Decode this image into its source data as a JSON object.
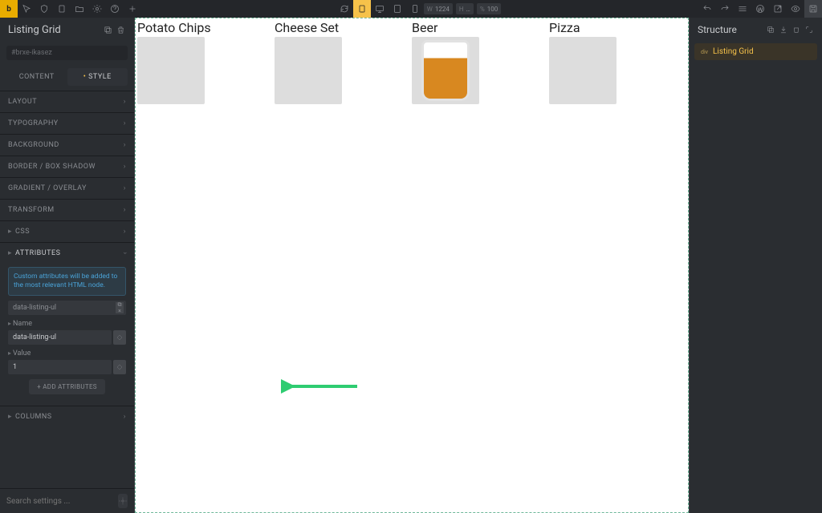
{
  "topbar": {
    "width_label": "W",
    "width_value": "1224",
    "height_label": "H",
    "height_value": "…",
    "zoom_label": "%",
    "zoom_value": "100"
  },
  "left": {
    "element_title": "Listing Grid",
    "search_placeholder": "#brxe-ikasez",
    "tabs": {
      "content": "CONTENT",
      "style": "STYLE"
    },
    "sections": {
      "layout": "LAYOUT",
      "typography": "TYPOGRAPHY",
      "background": "BACKGROUND",
      "border": "BORDER / BOX SHADOW",
      "gradient": "GRADIENT / OVERLAY",
      "transform": "TRANSFORM",
      "css": "CSS",
      "attributes": "ATTRIBUTES",
      "columns": "COLUMNS"
    },
    "attributes": {
      "note": "Custom attributes will be added to the most relevant HTML node.",
      "chip": "data-listing-ul",
      "name_label": "Name",
      "name_value": "data-listing-ul",
      "value_label": "Value",
      "value_value": "1",
      "add_btn": "+ ADD ATTRIBUTES"
    },
    "footer_placeholder": "Search settings ..."
  },
  "right": {
    "title": "Structure",
    "tree": {
      "type": "div",
      "label": "Listing Grid"
    }
  },
  "canvas": {
    "items": [
      {
        "title": "Potato Chips"
      },
      {
        "title": "Cheese Set"
      },
      {
        "title": "Beer"
      },
      {
        "title": "Pizza"
      }
    ]
  }
}
